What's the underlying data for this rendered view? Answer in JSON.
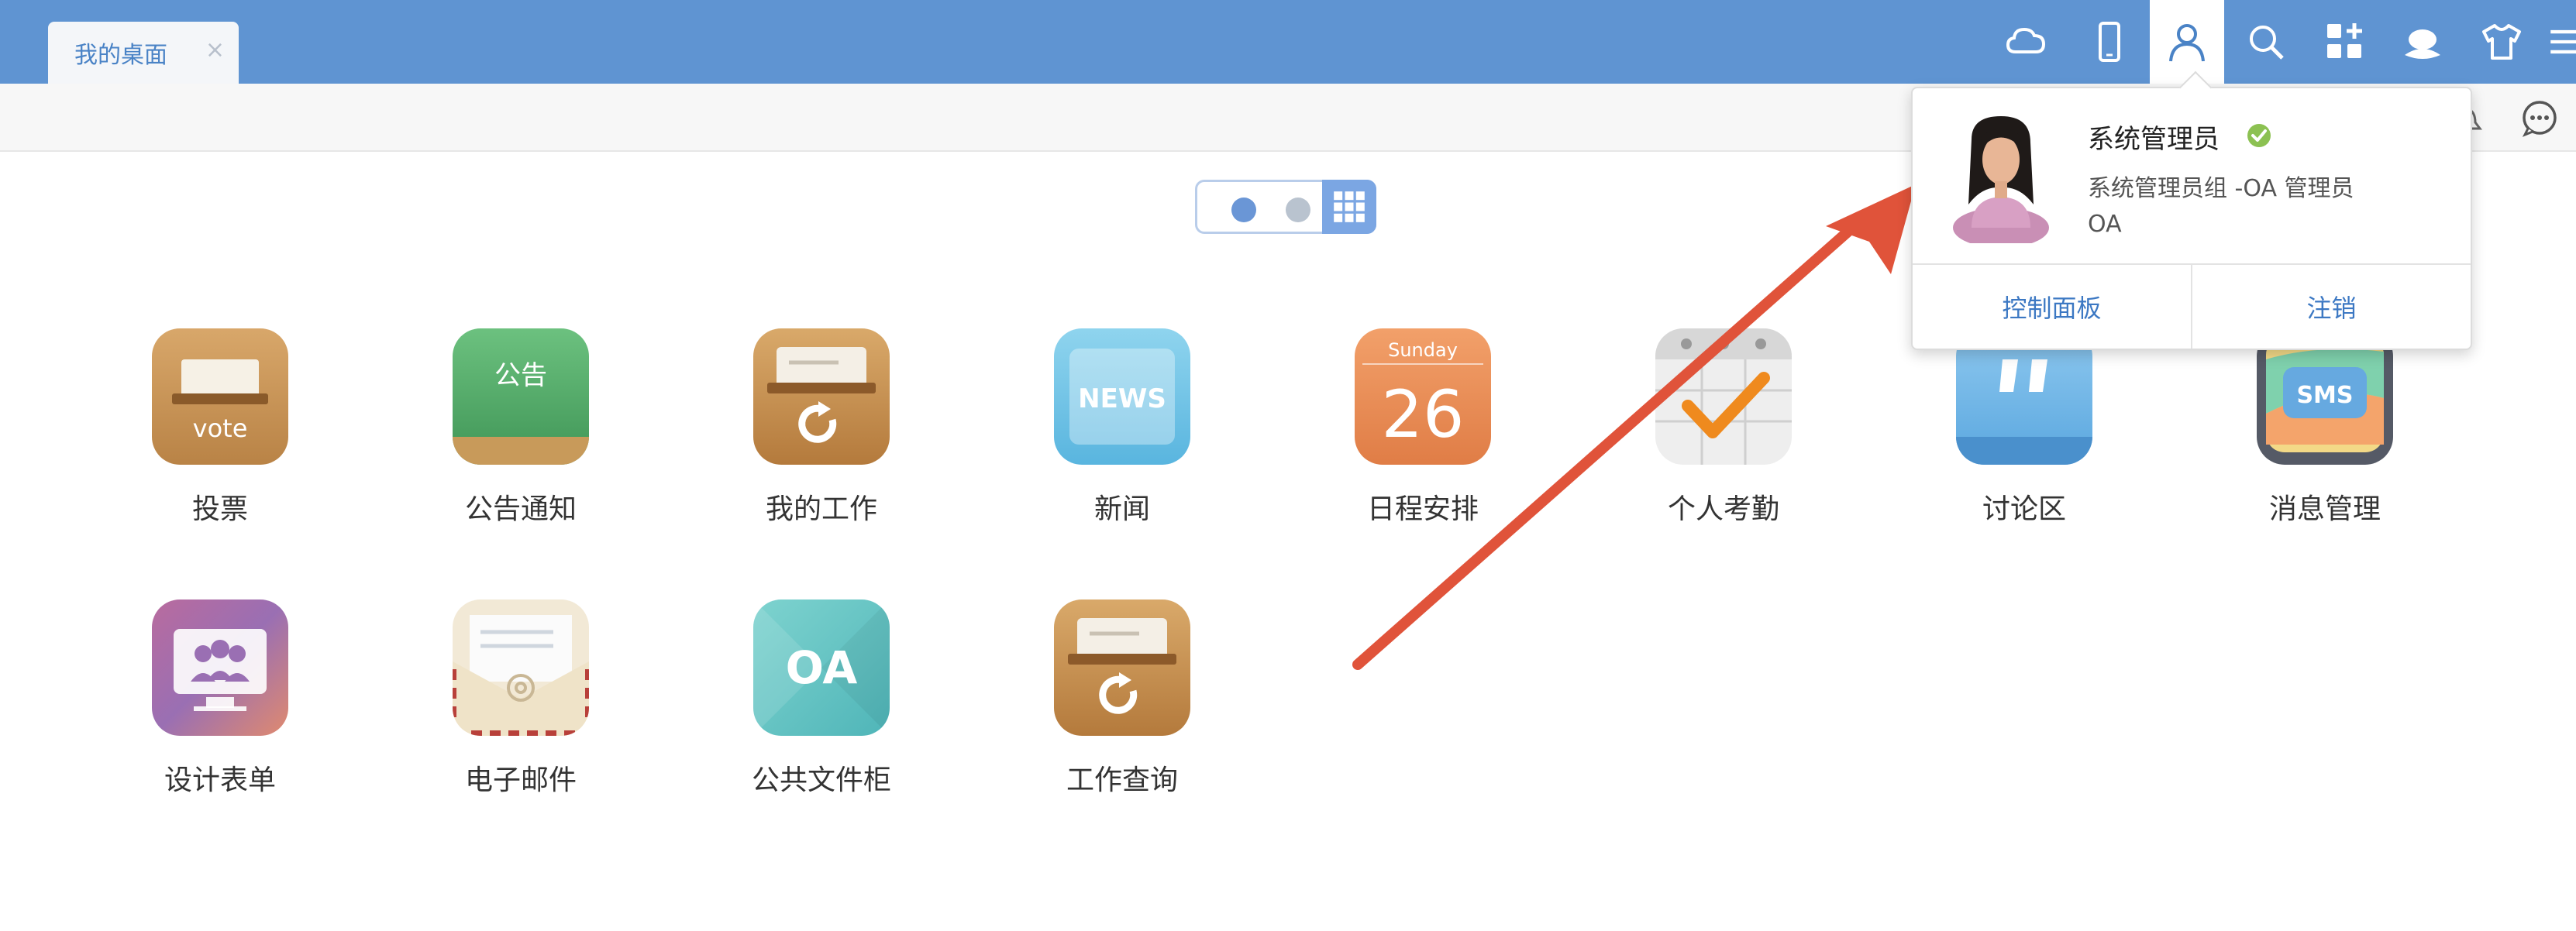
{
  "tabs": [
    {
      "label": "我的桌面",
      "close": "×"
    }
  ],
  "toolbar": {
    "icons": [
      "cloud-icon",
      "mobile-icon",
      "user-icon",
      "search-icon",
      "apps-add-icon",
      "avatar-status-icon",
      "theme-shirt-icon",
      "menu-icon"
    ],
    "active": "user-icon"
  },
  "subbar": {
    "icons": [
      "bell-icon",
      "chat-icon"
    ]
  },
  "pager": {
    "pages": 2,
    "current_page": 1
  },
  "apps": [
    {
      "label": "投票",
      "icon": "vote-icon",
      "icon_text": "vote"
    },
    {
      "label": "公告通知",
      "icon": "notice-board-icon",
      "icon_text": "公告"
    },
    {
      "label": "我的工作",
      "icon": "work-tray-icon"
    },
    {
      "label": "新闻",
      "icon": "news-icon",
      "icon_text": "NEWS"
    },
    {
      "label": "日程安排",
      "icon": "calendar-icon",
      "icon_text": "Sunday",
      "icon_number": "26"
    },
    {
      "label": "个人考勤",
      "icon": "attendance-check-icon"
    },
    {
      "label": "讨论区",
      "icon": "discussion-quote-icon"
    },
    {
      "label": "消息管理",
      "icon": "sms-icon",
      "icon_text": "SMS"
    },
    {
      "label": "设计表单",
      "icon": "form-design-icon"
    },
    {
      "label": "电子邮件",
      "icon": "email-envelope-icon"
    },
    {
      "label": "公共文件柜",
      "icon": "oa-cabinet-icon",
      "icon_text": "OA"
    },
    {
      "label": "工作查询",
      "icon": "work-query-icon"
    }
  ],
  "user_popup": {
    "name": "系统管理员",
    "role": "系统管理员组 -OA 管理员",
    "org": "OA",
    "control_panel": "控制面板",
    "logout": "注销"
  },
  "colors": {
    "topbar": "#5f94d2",
    "accent": "#3c78c3",
    "arrow": "#e0533a",
    "verified": "#8cc152"
  }
}
